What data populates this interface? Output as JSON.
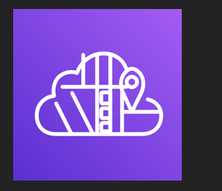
{
  "icon": {
    "name": "cloud-location-map-icon",
    "gradient_start": "#5a2fd1",
    "gradient_end": "#a45cf3",
    "stroke_color": "#ffffff",
    "background_color": "#232323"
  }
}
